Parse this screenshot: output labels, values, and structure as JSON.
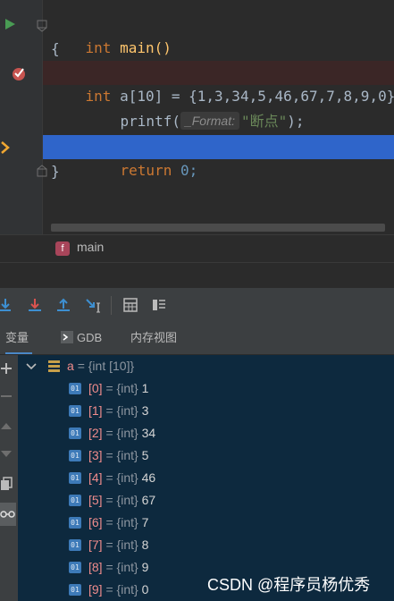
{
  "editor": {
    "line1": {
      "type": "int",
      "name": "main()"
    },
    "line2": "{",
    "line3": {
      "type": "int",
      "decl": "a[10] = {1,3,34,5,46,67,7,8,9,0};"
    },
    "line4": {
      "func": "printf(",
      "hint": "_Format:",
      "arg": "\"断点\"",
      "end": ");"
    },
    "line5": {
      "kw": "return",
      "val": "0;"
    },
    "line6": "}"
  },
  "breadcrumb": {
    "badge": "f",
    "label": "main"
  },
  "tabs": [
    {
      "label": "变量",
      "active": true
    },
    {
      "label": "GDB",
      "active": false
    },
    {
      "label": "内存视图",
      "active": false
    }
  ],
  "variables": {
    "root": {
      "name": "a",
      "type": "= {int [10]}"
    },
    "items": [
      {
        "index": "[0]",
        "type": "= {int}",
        "value": "1"
      },
      {
        "index": "[1]",
        "type": "= {int}",
        "value": "3"
      },
      {
        "index": "[2]",
        "type": "= {int}",
        "value": "34"
      },
      {
        "index": "[3]",
        "type": "= {int}",
        "value": "5"
      },
      {
        "index": "[4]",
        "type": "= {int}",
        "value": "46"
      },
      {
        "index": "[5]",
        "type": "= {int}",
        "value": "67"
      },
      {
        "index": "[6]",
        "type": "= {int}",
        "value": "7"
      },
      {
        "index": "[7]",
        "type": "= {int}",
        "value": "8"
      },
      {
        "index": "[8]",
        "type": "= {int}",
        "value": "9"
      },
      {
        "index": "[9]",
        "type": "= {int}",
        "value": "0"
      }
    ],
    "badge_text": "01"
  },
  "watermark": "CSDN @程序员杨优秀",
  "colors": {
    "exec_line": "#2f65ca",
    "breakpoint": "#c75450",
    "keyword": "#cc7832",
    "number": "#6897bb",
    "string": "#6a8759",
    "var_bg": "#0d293e"
  }
}
